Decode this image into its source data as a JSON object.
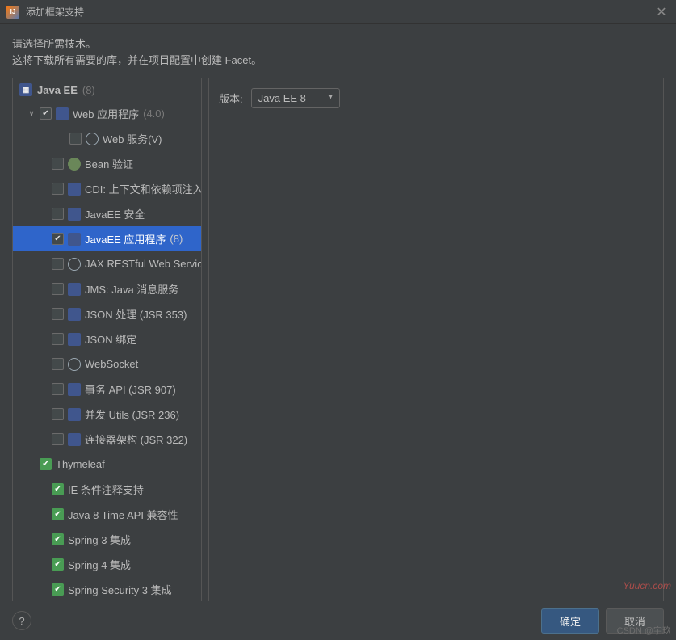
{
  "titlebar": {
    "title": "添加框架支持"
  },
  "instructions": {
    "line1": "请选择所需技术。",
    "line2": "这将下载所有需要的库，并在项目配置中创建 Facet。"
  },
  "tree": {
    "root": {
      "label": "Java EE",
      "suffix": "(8)"
    },
    "items": [
      {
        "id": "web-app",
        "label": "Web 应用程序",
        "suffix": "(4.0)",
        "level": 1,
        "checked": true,
        "green": false,
        "expanded": true,
        "hasToggle": true
      },
      {
        "id": "web-svc",
        "label": "Web 服务(V)",
        "suffix": "",
        "level": 3,
        "checked": false,
        "green": false
      },
      {
        "id": "bean",
        "label": "Bean 验证",
        "suffix": "",
        "level": 2,
        "checked": false,
        "green": false
      },
      {
        "id": "cdi",
        "label": "CDI: 上下文和依赖项注入",
        "suffix": "",
        "level": 2,
        "checked": false,
        "green": false
      },
      {
        "id": "security",
        "label": "JavaEE 安全",
        "suffix": "",
        "level": 2,
        "checked": false,
        "green": false
      },
      {
        "id": "javaee-app",
        "label": "JavaEE 应用程序",
        "suffix": "(8)",
        "level": 2,
        "checked": true,
        "green": false,
        "selected": true
      },
      {
        "id": "jaxrs",
        "label": "JAX RESTful Web Services",
        "suffix": "",
        "level": 2,
        "checked": false,
        "green": false
      },
      {
        "id": "jms",
        "label": "JMS: Java 消息服务",
        "suffix": "",
        "level": 2,
        "checked": false,
        "green": false
      },
      {
        "id": "jsonp",
        "label": "JSON 处理 (JSR 353)",
        "suffix": "",
        "level": 2,
        "checked": false,
        "green": false
      },
      {
        "id": "jsonb",
        "label": "JSON 绑定",
        "suffix": "",
        "level": 2,
        "checked": false,
        "green": false
      },
      {
        "id": "websocket",
        "label": "WebSocket",
        "suffix": "",
        "level": 2,
        "checked": false,
        "green": false
      },
      {
        "id": "batch",
        "label": "事务 API (JSR 907)",
        "suffix": "",
        "level": 2,
        "checked": false,
        "green": false
      },
      {
        "id": "concurrency",
        "label": "并发 Utils (JSR 236)",
        "suffix": "",
        "level": 2,
        "checked": false,
        "green": false
      },
      {
        "id": "connector",
        "label": "连接器架构 (JSR 322)",
        "suffix": "",
        "level": 2,
        "checked": false,
        "green": false
      },
      {
        "id": "thymeleaf",
        "label": "Thymeleaf",
        "suffix": "",
        "level": 1,
        "checked": false,
        "green": true,
        "noIndent": true
      },
      {
        "id": "ie-cond",
        "label": "IE 条件注释支持",
        "suffix": "",
        "level": 2,
        "checked": false,
        "green": true
      },
      {
        "id": "java8time",
        "label": "Java 8 Time API 兼容性",
        "suffix": "",
        "level": 2,
        "checked": false,
        "green": true
      },
      {
        "id": "spring3",
        "label": "Spring 3 集成",
        "suffix": "",
        "level": 2,
        "checked": false,
        "green": true
      },
      {
        "id": "spring4",
        "label": "Spring 4 集成",
        "suffix": "",
        "level": 2,
        "checked": false,
        "green": true
      },
      {
        "id": "springsec",
        "label": "Spring Security 3 集成",
        "suffix": "",
        "level": 2,
        "checked": false,
        "green": true
      }
    ]
  },
  "right": {
    "version_label": "版本:",
    "version_value": "Java EE 8"
  },
  "footer": {
    "help": "?",
    "ok": "确定",
    "cancel": "取消"
  },
  "watermarks": {
    "w1": "Yuucn.com",
    "w2": "CSDN @宇玖"
  }
}
